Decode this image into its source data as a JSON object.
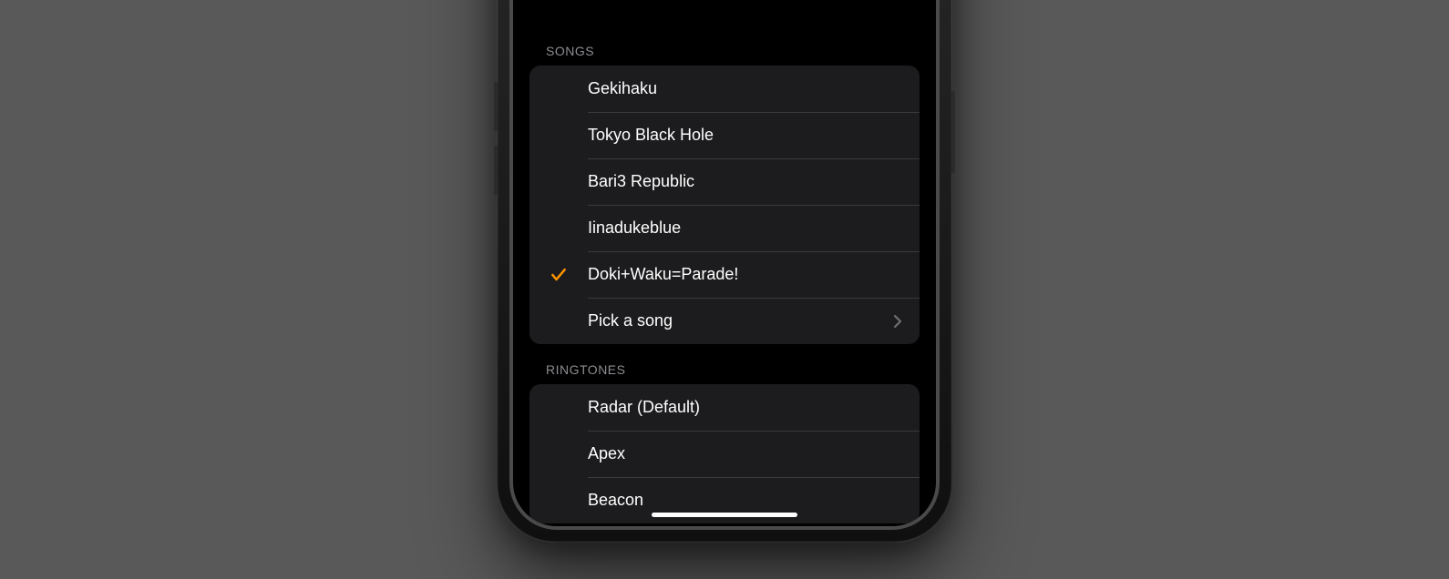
{
  "accent": "#ff9500",
  "sections": {
    "songs": {
      "header": "SONGS",
      "items": [
        {
          "label": "Gekihaku",
          "selected": false
        },
        {
          "label": "Tokyo Black Hole",
          "selected": false
        },
        {
          "label": "Bari3 Republic",
          "selected": false
        },
        {
          "label": "Iinadukeblue",
          "selected": false
        },
        {
          "label": "Doki+Waku=Parade!",
          "selected": true
        }
      ],
      "pick_label": "Pick a song"
    },
    "ringtones": {
      "header": "RINGTONES",
      "items": [
        {
          "label": "Radar (Default)",
          "selected": false
        },
        {
          "label": "Apex",
          "selected": false
        },
        {
          "label": "Beacon",
          "selected": false
        }
      ]
    }
  }
}
